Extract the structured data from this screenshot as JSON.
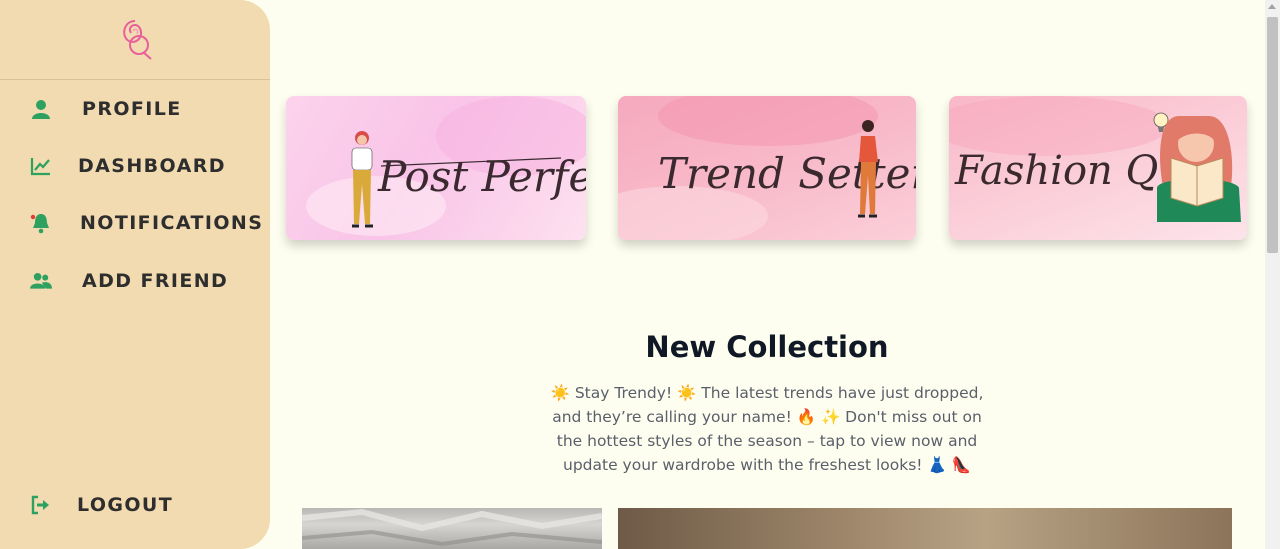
{
  "sidebar": {
    "logo_icon": "brand-logo",
    "items": [
      {
        "label": "PROFILE",
        "icon": "user-icon"
      },
      {
        "label": "DASHBOARD",
        "icon": "chart-line-icon"
      },
      {
        "label": "NOTIFICATIONS",
        "icon": "bell-icon"
      },
      {
        "label": "ADD FRIEND",
        "icon": "users-icon"
      }
    ],
    "logout": {
      "label": "LOGOUT",
      "icon": "logout-icon"
    },
    "accent_color": "#2ea160",
    "background_color": "#f2dbb0"
  },
  "banners": [
    {
      "title": "Post Perfect"
    },
    {
      "title": "Trend Setter"
    },
    {
      "title": "Fashion Quiz"
    }
  ],
  "collection": {
    "title": "New Collection",
    "description": "☀️ Stay Trendy! ☀️ The latest trends have just dropped, and they’re calling your name! 🔥 ✨ Don't miss out on the hottest styles of the season – tap to view now and update your wardrobe with the freshest looks! 👗 👠"
  }
}
